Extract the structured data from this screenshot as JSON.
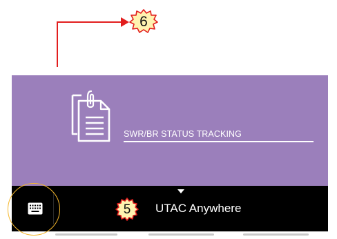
{
  "callouts": {
    "top_number": "6",
    "bottom_number": "5",
    "line_color": "#e21d1d",
    "badge_fill": "#fff3b0",
    "badge_stroke": "#e21d1d",
    "highlight_color": "#f5b72b"
  },
  "tile": {
    "label": "SWR/BR STATUS TRACKING",
    "background": "#9b7fbb",
    "icon": "clipboard-document-icon"
  },
  "bottom_bar": {
    "title": "UTAC Anywhere",
    "keyboard_icon": "keyboard-icon",
    "handle_icon": "caret-down-icon",
    "background": "#000000"
  }
}
